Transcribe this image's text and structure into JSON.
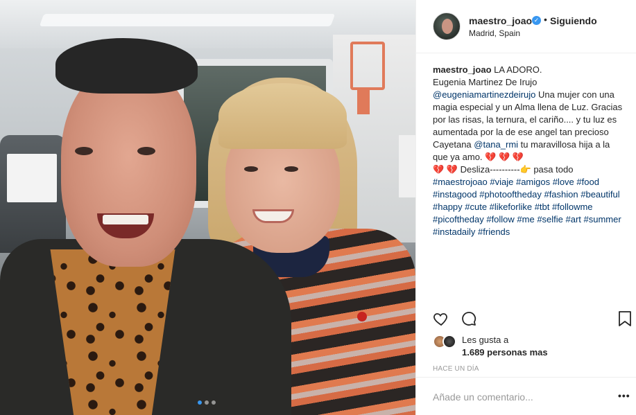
{
  "post": {
    "carousel": {
      "total": 3,
      "active": 0
    }
  },
  "header": {
    "username": "maestro_joao",
    "verified": "✓",
    "separator": "•",
    "follow_status": "Siguiendo",
    "location": "Madrid, Spain"
  },
  "caption": {
    "username": "maestro_joao",
    "line1": " LA ADORO.",
    "line2": "Eugenia Martinez De Irujo",
    "mention1": "@eugeniamartinezdeirujo",
    "text1": " Una mujer con una magia especial y un Alma llena de Luz. Gracias por las risas, la ternura, el cariño.... y tu luz es aumentada por la de ese angel tan precioso Cayetana ",
    "mention2": "@tana_rmi",
    "text2": " tu maravillosa hija a la que ya amo. ",
    "hearts1": "💔 💔 💔",
    "hearts2": "💔 💔",
    "swipe": " Desliza----------",
    "swipe_icon": "👉",
    "swipe_end": " pasa todo",
    "hashtags": "#maestrojoao #viaje #amigos #love #food #instagood #photooftheday #fashion #beautiful #happy #cute #likeforlike #tbt #followme #picoftheday #follow #me #selfie #art #summer #instadaily #friends"
  },
  "actions": {
    "like_icon": "heart-outline-icon",
    "comment_icon": "comment-icon",
    "save_icon": "bookmark-icon"
  },
  "likes": {
    "label": "Les gusta a",
    "count": "1.689",
    "count_suffix": " personas mas"
  },
  "timeago": "HACE UN DÍA",
  "comment": {
    "placeholder": "Añade un comentario...",
    "more_label": "•••"
  },
  "colors": {
    "verified_blue": "#3897f0",
    "link_blue": "#003569",
    "text": "#262626",
    "muted": "#999999"
  }
}
